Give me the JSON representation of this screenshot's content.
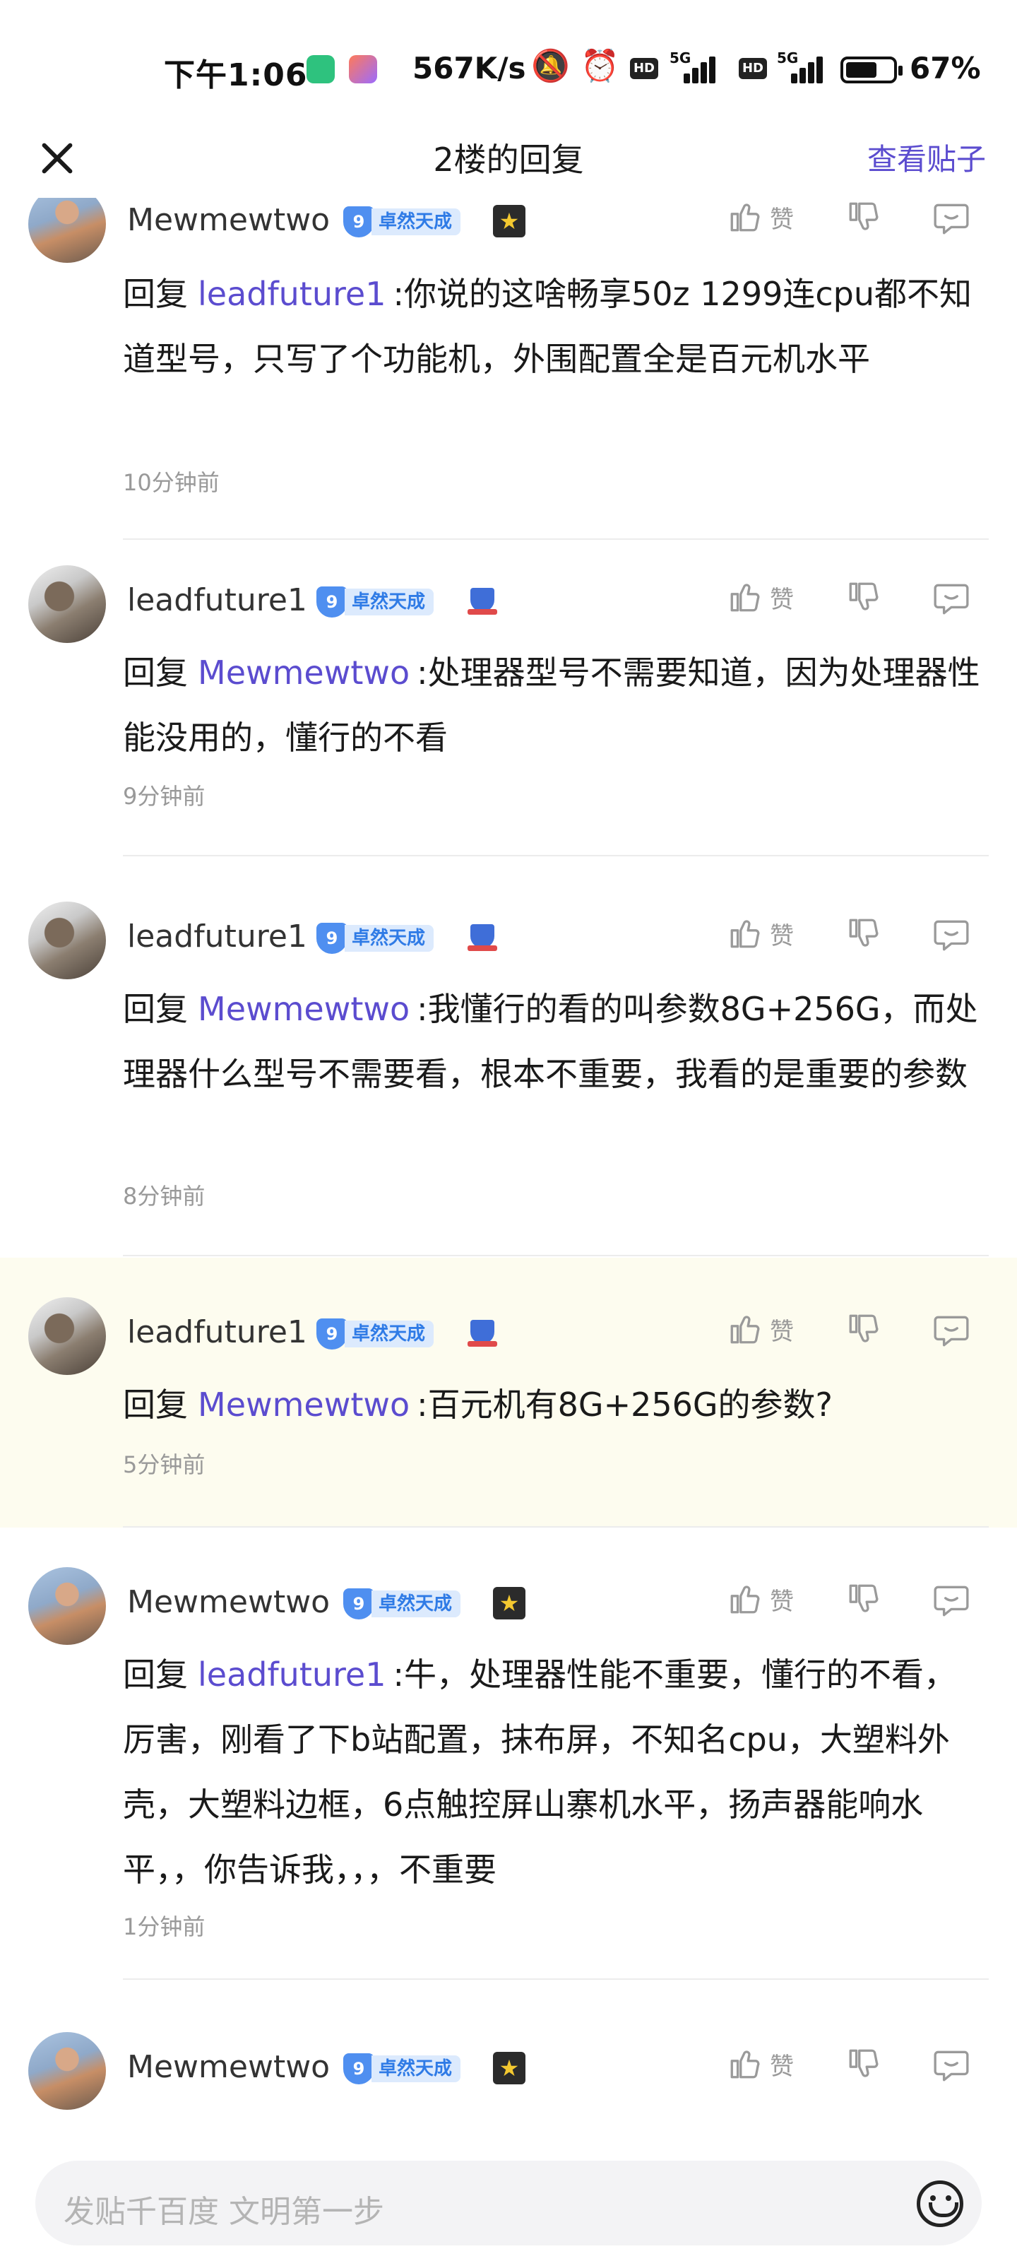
{
  "status_bar": {
    "time": "下午1:06",
    "net_speed": "567K/s",
    "network_1": "5G",
    "network_2": "5G",
    "hd_1": "HD",
    "hd_2": "HD",
    "battery_percent": 67,
    "battery_text": "67%",
    "icons": [
      "shield-app-icon",
      "game-app-icon",
      "mute-icon",
      "alarm-icon",
      "hd-icon",
      "signal-icon",
      "battery-icon"
    ]
  },
  "header": {
    "title": "2楼的回复",
    "view_post": "查看贴子"
  },
  "comments": [
    {
      "user": "Mewmewtwo",
      "level": "9",
      "level_name": "卓然天成",
      "reply_prefix": "回复",
      "mention": "leadfuture1",
      "text": ":你说的这啥畅享50z 1299连cpu都不知道型号，只写了个功能机，外围配置全是百元机水平",
      "time": "10分钟前",
      "like_label": "赞"
    },
    {
      "user": "leadfuture1",
      "level": "9",
      "level_name": "卓然天成",
      "reply_prefix": "回复",
      "mention": "Mewmewtwo",
      "text": ":处理器型号不需要知道，因为处理器性能没用的，懂行的不看",
      "time": "9分钟前",
      "like_label": "赞"
    },
    {
      "user": "leadfuture1",
      "level": "9",
      "level_name": "卓然天成",
      "reply_prefix": "回复",
      "mention": "Mewmewtwo",
      "text": ":我懂行的看的叫参数8G+256G，而处理器什么型号不需要看，根本不重要，我看的是重要的参数",
      "time": "8分钟前",
      "like_label": "赞"
    },
    {
      "user": "leadfuture1",
      "level": "9",
      "level_name": "卓然天成",
      "reply_prefix": "回复",
      "mention": "Mewmewtwo",
      "text": ":百元机有8G+256G的参数?",
      "time": "5分钟前",
      "like_label": "赞"
    },
    {
      "user": "Mewmewtwo",
      "level": "9",
      "level_name": "卓然天成",
      "reply_prefix": "回复",
      "mention": "leadfuture1",
      "text": ":牛，处理器性能不重要，懂行的不看，厉害，刚看了下b站配置，抹布屏，不知名cpu，大塑料外壳，大塑料边框，6点触控屏山寨机水平，扬声器能响水平，，你告诉我，，，不重要",
      "time": "1分钟前",
      "like_label": "赞"
    },
    {
      "user": "Mewmewtwo",
      "level": "9",
      "level_name": "卓然天成",
      "like_label": "赞"
    }
  ],
  "input": {
    "placeholder": "发贴千百度 文明第一步"
  },
  "colors": {
    "accent": "#5b4ccf",
    "level_badge": "#4f8ff0",
    "highlight_bg": "#fdfcef"
  }
}
